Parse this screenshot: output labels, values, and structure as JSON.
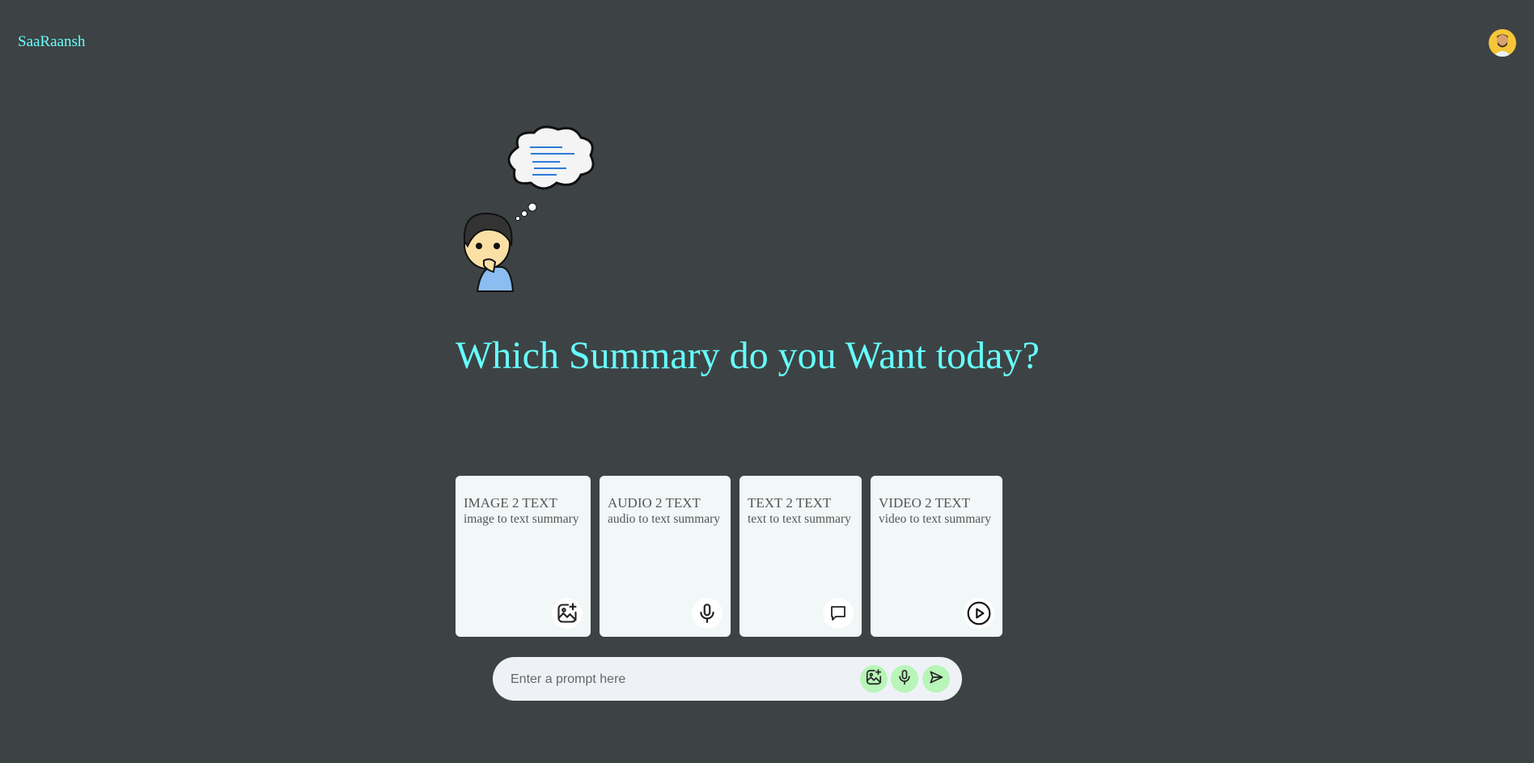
{
  "header": {
    "logo": "SaaRaansh"
  },
  "hero": {
    "heading": "Which Summary do you Want today?"
  },
  "cards": [
    {
      "title": "IMAGE 2 TEXT",
      "subtitle": "image to text summary",
      "icon": "image-plus-icon"
    },
    {
      "title": "AUDIO 2 TEXT",
      "subtitle": "audio to text summary",
      "icon": "mic-icon"
    },
    {
      "title": "TEXT 2 TEXT",
      "subtitle": "text to text summary",
      "icon": "message-icon"
    },
    {
      "title": "VIDEO 2 TEXT",
      "subtitle": "video to text summary",
      "icon": "play-circle-icon"
    }
  ],
  "prompt": {
    "placeholder": "Enter a prompt here",
    "value": ""
  },
  "colors": {
    "background": "#3d4344",
    "accent": "#66ffff",
    "card": "#f2f8f8",
    "button": "#b8f5b8"
  }
}
